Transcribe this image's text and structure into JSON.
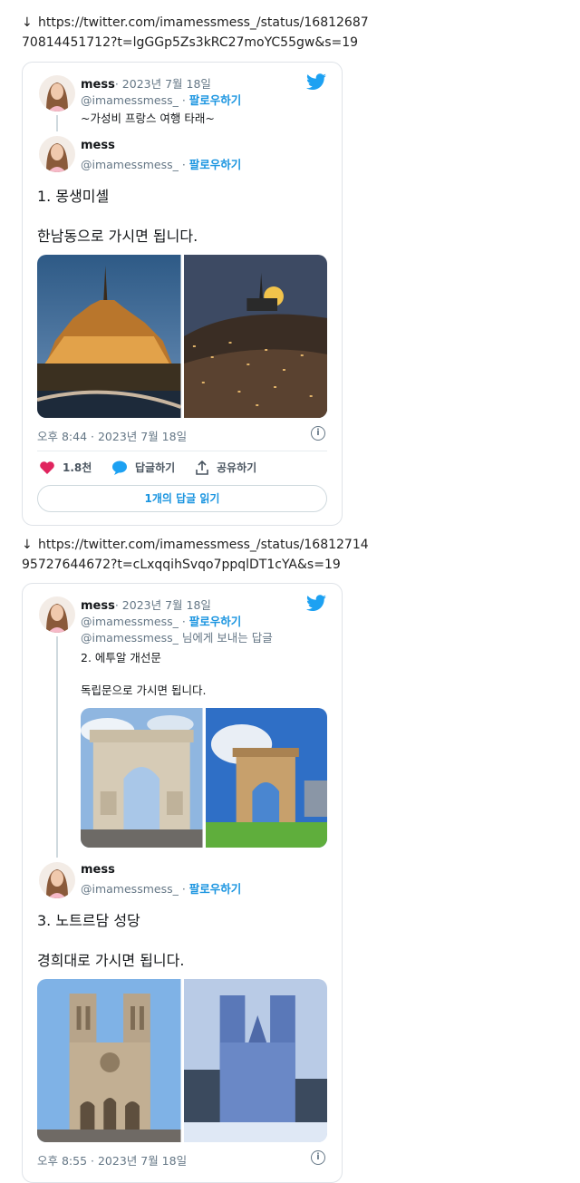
{
  "posts": [
    {
      "link": {
        "arrow": "↓",
        "line1": "https://twitter.com/imamessmess_/status/16812687",
        "line2": "70814451712?t=lgGGp5Zs3kRC27moYC55gw&s=19"
      },
      "quoted": {
        "name": "mess",
        "date": "· 2023년 7월 18일",
        "handle": "@imamessmess_ ·",
        "follow": "팔로우하기",
        "text": "~가성비 프랑스 여행 타래~"
      },
      "main": {
        "name": "mess",
        "handle": "@imamessmess_ ·",
        "follow": "팔로우하기",
        "line1": "1. 몽생미셸",
        "line2": "한남동으로 가시면 됩니다.",
        "images": [
          "Mont-Saint-Michel at night",
          "Hannam-dong hillside at night"
        ],
        "timestamp": "오후 8:44 · 2023년 7월 18일",
        "likes": "1.8천",
        "reply_label": "답글하기",
        "share_label": "공유하기",
        "read_replies": "1개의 답글 읽기"
      }
    },
    {
      "link": {
        "arrow": "↓",
        "line1": "https://twitter.com/imamessmess_/status/16812714",
        "line2": "95727644672?t=cLxqqihSvqo7ppqlDT1cYA&s=19"
      },
      "quoted": {
        "name": "mess",
        "date": "· 2023년 7월 18일",
        "handle": "@imamessmess_ ·",
        "follow": "팔로우하기",
        "reply_to": "@imamessmess_ 님에게 보내는 답글",
        "text1": "2. 에투알 개선문",
        "text2": "독립문으로 가시면 됩니다.",
        "images": [
          "Arc de Triomphe",
          "Independence Gate Seoul"
        ]
      },
      "main": {
        "name": "mess",
        "handle": "@imamessmess_ ·",
        "follow": "팔로우하기",
        "line1": "3. 노트르담 성당",
        "line2": "경희대로 가시면 됩니다.",
        "images": [
          "Notre-Dame de Paris",
          "Kyung Hee University hall"
        ],
        "timestamp": "오후 8:55 · 2023년 7월 18일"
      }
    }
  ],
  "icons": {
    "brand_color": "#1da1f2",
    "like_color": "#e0245e",
    "reply_color": "#1da1f2"
  }
}
